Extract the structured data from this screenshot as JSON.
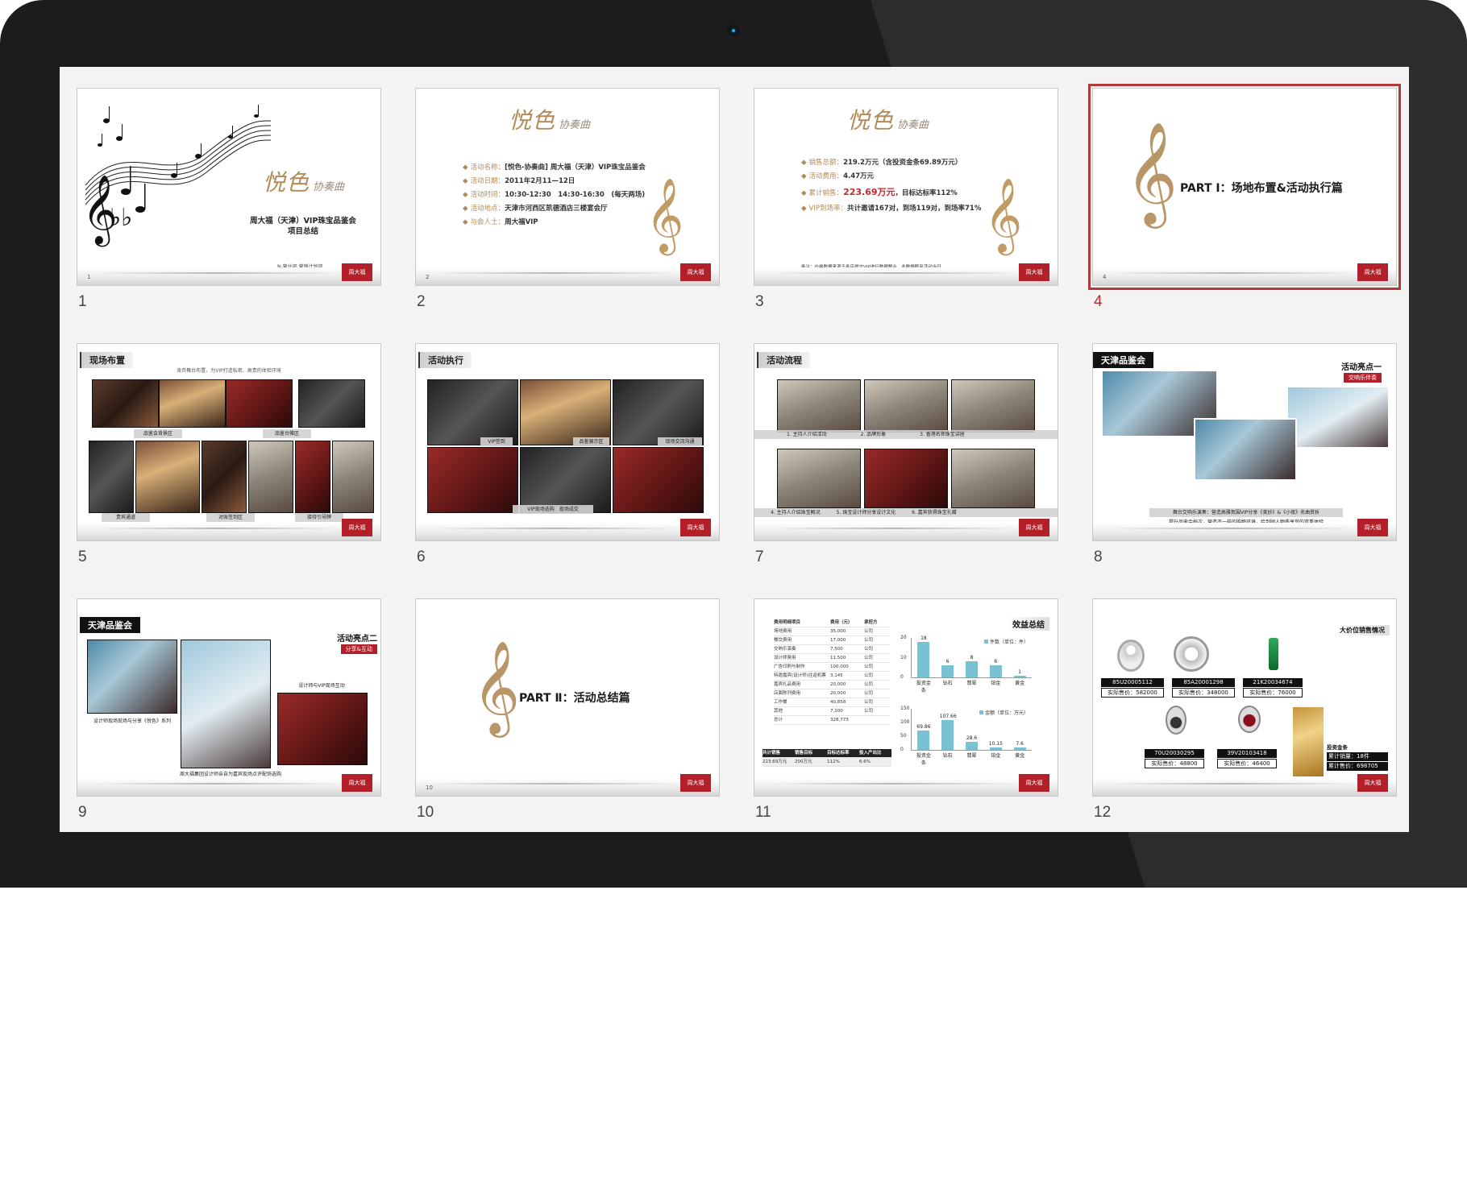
{
  "slides": [
    {
      "number": "1",
      "brand": "悦色",
      "brand_sub": "协奏曲",
      "title_line1": "周大福（天津）VIP珠宝品鉴会",
      "title_line2": "项目总结",
      "footer_text": "N-营业部 营销计划部"
    },
    {
      "number": "2",
      "brand": "悦色",
      "brand_sub": "协奏曲",
      "lines": [
        {
          "k": "活动名称：",
          "v": "[悦色-协奏曲] 周大福（天津）VIP珠宝品鉴会"
        },
        {
          "k": "活动日期：",
          "v": "2011年2月11—12日"
        },
        {
          "k": "活动时间：",
          "v": "10:30-12:30　14:30-16:30　(每天两场)"
        },
        {
          "k": "活动地点：",
          "v": "天津市河西区凯德酒店三楼宴会厅"
        },
        {
          "k": "与会人士：",
          "v": "周大福VIP"
        }
      ],
      "page": "2"
    },
    {
      "number": "3",
      "brand": "悦色",
      "brand_sub": "协奏曲",
      "lines": [
        {
          "k": "销售总额：",
          "v": "219.2万元（含投资金条69.89万元）"
        },
        {
          "k": "活动费用：",
          "v": "4.47万元"
        },
        {
          "k": "累计销售：",
          "v_red": "223.69万元",
          "v": "，目标达标率112%"
        },
        {
          "k": "VIP到场率：",
          "v": "共计邀请167对，到场119对，到场率71%"
        }
      ],
      "note": "备注：价格数据来源于各店提交VIP进行数据整合，此数据截至活动当日"
    },
    {
      "number": "4",
      "title": "PART Ⅰ：场地布置&活动执行篇",
      "page": "4"
    },
    {
      "number": "5",
      "tag": "现场布置",
      "subtitle": "舍弃舞台布置，为VIP打造私密、高贵的体验环境",
      "captions": [
        "品鉴会背景区",
        "品鉴台帷区",
        "贵宾通道",
        "对账签到区",
        "接待引导牌"
      ]
    },
    {
      "number": "6",
      "tag": "活动执行",
      "captions": [
        "VIP签到",
        "品鉴展示区",
        "现场交流沟通",
        "VIP现场选购　现场成交"
      ]
    },
    {
      "number": "7",
      "tag": "活动流程",
      "captions": [
        "1. 主持人介绍活动",
        "2. 品牌形象",
        "3. 香港名师珠宝讲座",
        "4. 主持人介绍珠宝概况",
        "5. 珠宝设计师分享设计文化",
        "6. 嘉宾获得珠宝礼赠"
      ]
    },
    {
      "number": "8",
      "tag": "天津品鉴会",
      "highlight_title": "活动亮点一",
      "highlight_sub": "交响乐伴奏",
      "caption1": "舞台交响乐演奏：营造高雅氛围VIP分享《美妙》&《小夜》名曲赏析",
      "caption2": "提升品鉴会档次，营造不一样的购物环境，给到顾人物质享受的双重体验"
    },
    {
      "number": "9",
      "tag": "天津品鉴会",
      "highlight_title": "活动亮点二",
      "highlight_sub": "分享&互动",
      "caption1": "设计师与VIP现场互动",
      "caption2": "设计师现场现场与分享《悦色》系列",
      "caption3": "周大福集团设计师亲自为嘉宾现场点评配饰选购"
    },
    {
      "number": "10",
      "title": "PART Ⅱ：活动总结篇",
      "page": "10"
    },
    {
      "number": "11",
      "title": "效益总结",
      "table_head": [
        "费用明细项目",
        "费用（元）",
        "承担方"
      ],
      "table_rows": [
        [
          "场地费用",
          "35,000",
          "公司"
        ],
        [
          "餐饮费用",
          "17,000",
          "公司"
        ],
        [
          "交响乐演奏",
          "7,500",
          "公司"
        ],
        [
          "设计师费用",
          "11,500",
          "公司"
        ],
        [
          "广告印刷与制作",
          "100,000",
          "公司"
        ],
        [
          "特邀嘉宾(设计师)往返机票",
          "3,145",
          "公司"
        ],
        [
          "嘉宾礼品费用",
          "20,000",
          "公司"
        ],
        [
          "店面陈列费用",
          "20,000",
          "公司"
        ],
        [
          "工作餐",
          "40,858",
          "公司"
        ],
        [
          "其他",
          "7,100",
          "公司"
        ],
        [
          "总计",
          "328,773",
          ""
        ]
      ],
      "summary_head": [
        "共计销售",
        "销售目标",
        "目标达标率",
        "投入产出比"
      ],
      "summary_row": [
        "223.69万元",
        "200万元",
        "112%",
        "6.6%"
      ],
      "chart_data": [
        {
          "type": "bar",
          "legend": "件数（单位：件）",
          "categories": [
            "投资金条",
            "钻石",
            "翡翠",
            "铂金",
            "黄金"
          ],
          "values": [
            18,
            6,
            8,
            6,
            1
          ],
          "ylim": [
            0,
            20
          ],
          "yticks": [
            "20",
            "10",
            "0"
          ]
        },
        {
          "type": "bar",
          "legend": "金额（单位：万元）",
          "categories": [
            "投资金条",
            "钻石",
            "翡翠",
            "铂金",
            "黄金"
          ],
          "values": [
            69.86,
            107.66,
            28.6,
            10.15,
            7.6
          ],
          "value_labels": [
            "69.86",
            "107.66",
            "28.6",
            "10.15",
            "7.6"
          ],
          "ylim": [
            0,
            150
          ],
          "yticks": [
            "150",
            "100",
            "50",
            "0"
          ]
        }
      ]
    },
    {
      "number": "12",
      "title": "大价位销售情况",
      "items": [
        {
          "code": "85U20005112",
          "price": "实际售价：582000"
        },
        {
          "code": "85A20001298",
          "price": "实际售价：348000"
        },
        {
          "code": "21K20034674",
          "price": "实际售价：76000"
        },
        {
          "code": "70U20030295",
          "price": "实际售价：48800"
        },
        {
          "code": "39V20103418",
          "price": "实际售价：46400"
        }
      ],
      "gold": {
        "title": "投资金条",
        "line1": "累计销量：18件",
        "line2": "累计售价：698705"
      }
    }
  ],
  "logo_text": "周大福",
  "selected_slide": "4",
  "colors": {
    "accent": "#b03a3a",
    "gold": "#b38b58",
    "bezel": "#1c1c1c",
    "bar": "#7bc1d4"
  }
}
